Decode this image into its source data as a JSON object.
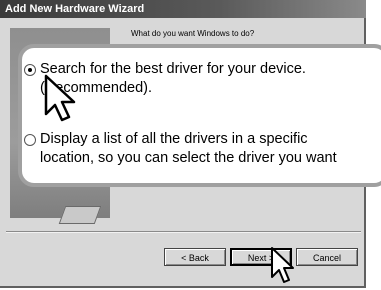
{
  "window": {
    "title": "Add New Hardware Wizard",
    "question": "What do you want Windows to do?"
  },
  "options": [
    {
      "line1": "Search for the best driver for your device.",
      "line2": "(Recommended).",
      "selected": true
    },
    {
      "line1": "Display a list of all the drivers in a specific",
      "line2": "location, so you can select the driver you want",
      "selected": false
    }
  ],
  "buttons": {
    "back": "< Back",
    "next": "Next >",
    "cancel": "Cancel"
  },
  "icons": [
    "radio-selected-icon",
    "radio-unselected-icon",
    "arrow-cursor-icon"
  ]
}
